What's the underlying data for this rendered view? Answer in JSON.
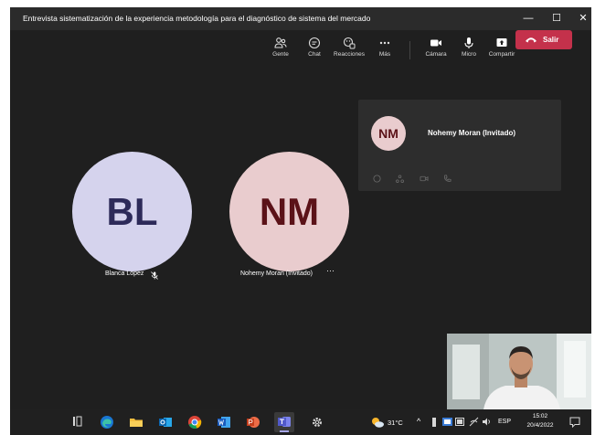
{
  "window": {
    "title": "Entrevista sistematización de la experiencia metodología para el diagnóstico de sistema del mercado",
    "minimize": "—",
    "maximize": "☐",
    "close": "✕"
  },
  "toolbar": {
    "people": "Gente",
    "chat": "Chat",
    "reactions": "Reacciones",
    "more": "Más",
    "camera": "Cámara",
    "mic": "Micro",
    "share": "Compartir",
    "leave": "Salir"
  },
  "participants": [
    {
      "initials": "BL",
      "name": "Blanca Lopez",
      "color": "#d5d3ed",
      "text_color": "#2d2a59"
    },
    {
      "initials": "NM",
      "name": "Nohemy Moran (Invitado)",
      "color": "#e9ccce",
      "text_color": "#5b1218"
    }
  ],
  "card": {
    "initials": "NM",
    "name": "Nohemy Moran (Invitado)"
  },
  "more_dots": "···",
  "taskbar": {
    "weather": "31°C",
    "lang": "ESP",
    "time": "15:02",
    "date": "20/4/2022"
  },
  "colors": {
    "leave": "#c4314b",
    "background": "#1f1f1f"
  }
}
